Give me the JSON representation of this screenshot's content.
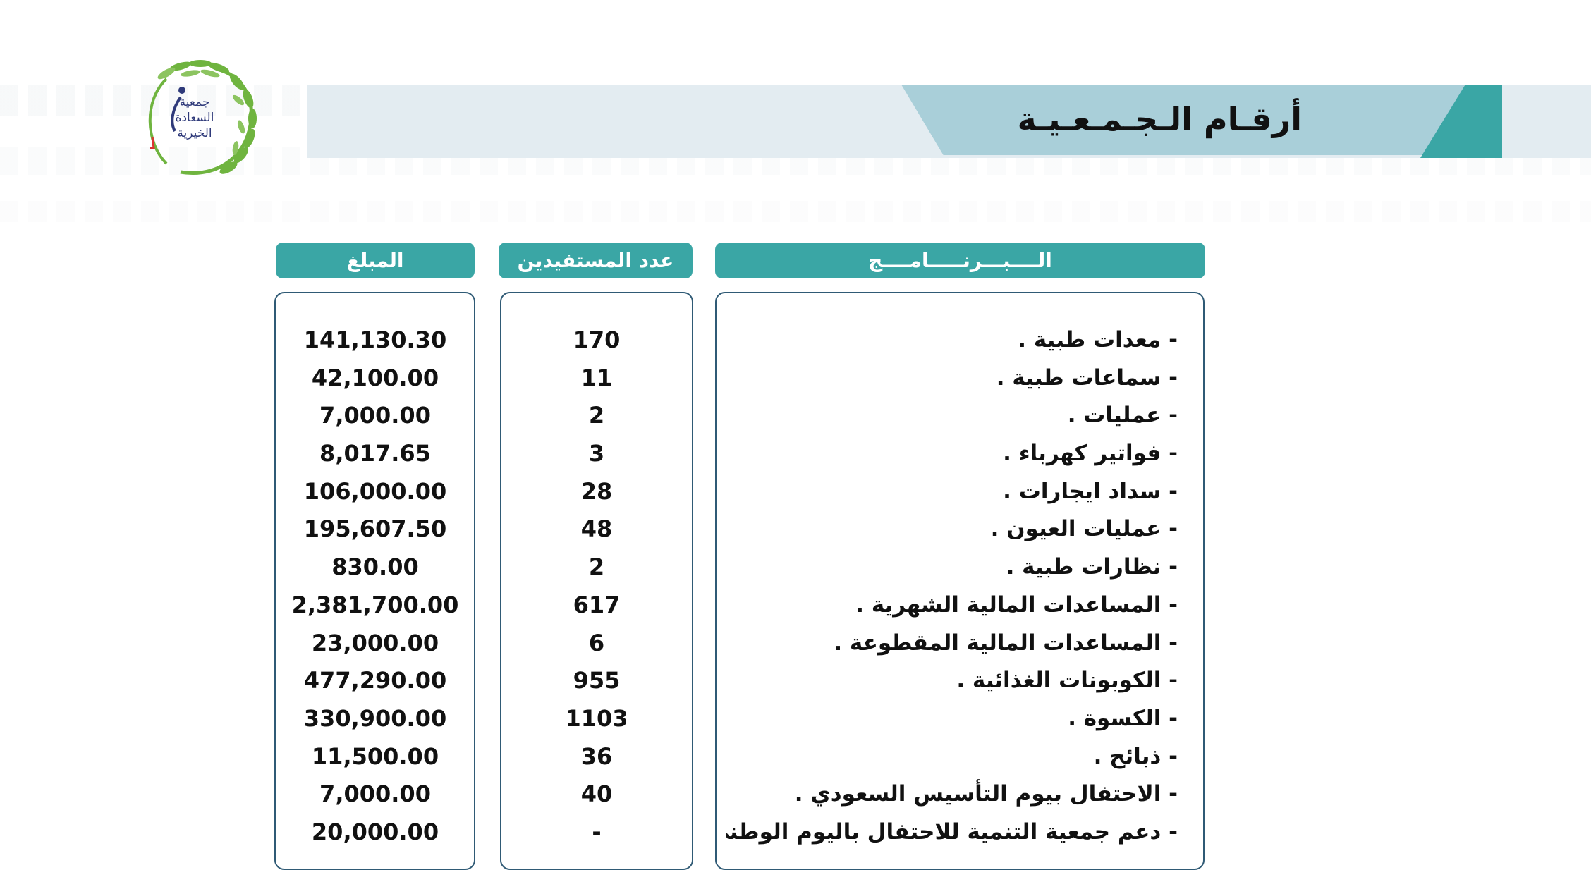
{
  "header": {
    "title": "أرقـام الـجـمـعـيـة"
  },
  "logo": {
    "lines": [
      "جمعية",
      "السعادة",
      "الخيرية"
    ]
  },
  "columns": {
    "amount": "المبلغ",
    "beneficiaries": "عدد المستفيدين",
    "program": "الــــبـــرنـــــامــــج"
  },
  "rows": [
    {
      "program": "- معدات طبية .",
      "beneficiaries": "170",
      "amount": "141,130.30"
    },
    {
      "program": "- سماعات طبية .",
      "beneficiaries": "11",
      "amount": "42,100.00"
    },
    {
      "program": "- عمليات .",
      "beneficiaries": "2",
      "amount": "7,000.00"
    },
    {
      "program": "- فواتير كهرباء .",
      "beneficiaries": "3",
      "amount": "8,017.65"
    },
    {
      "program": "- سداد ايجارات .",
      "beneficiaries": "28",
      "amount": "106,000.00"
    },
    {
      "program": "- عمليات العيون .",
      "beneficiaries": "48",
      "amount": "195,607.50"
    },
    {
      "program": "- نظارات طبية .",
      "beneficiaries": "2",
      "amount": "830.00"
    },
    {
      "program": "- المساعدات المالية الشهرية .",
      "beneficiaries": "617",
      "amount": "2,381,700.00"
    },
    {
      "program": "- المساعدات المالية المقطوعة .",
      "beneficiaries": "6",
      "amount": "23,000.00"
    },
    {
      "program": "- الكوبونات الغذائية .",
      "beneficiaries": "955",
      "amount": "477,290.00"
    },
    {
      "program": "- الكسوة .",
      "beneficiaries": "1103",
      "amount": "330,900.00"
    },
    {
      "program": "- ذبائح .",
      "beneficiaries": "36",
      "amount": "11,500.00"
    },
    {
      "program": "- الاحتفال بيوم التأسيس السعودي .",
      "beneficiaries": "40",
      "amount": "7,000.00"
    },
    {
      "program": "- دعم جمعية التنمية للاحتفال باليوم الوطني .",
      "beneficiaries": "-",
      "amount": "20,000.00"
    }
  ],
  "colors": {
    "accent": "#3aa6a5",
    "header_light": "#a9cfd9",
    "header_band": "#e3ecf1",
    "box_border": "#2f5a75",
    "logo_green": "#6fb43f"
  }
}
